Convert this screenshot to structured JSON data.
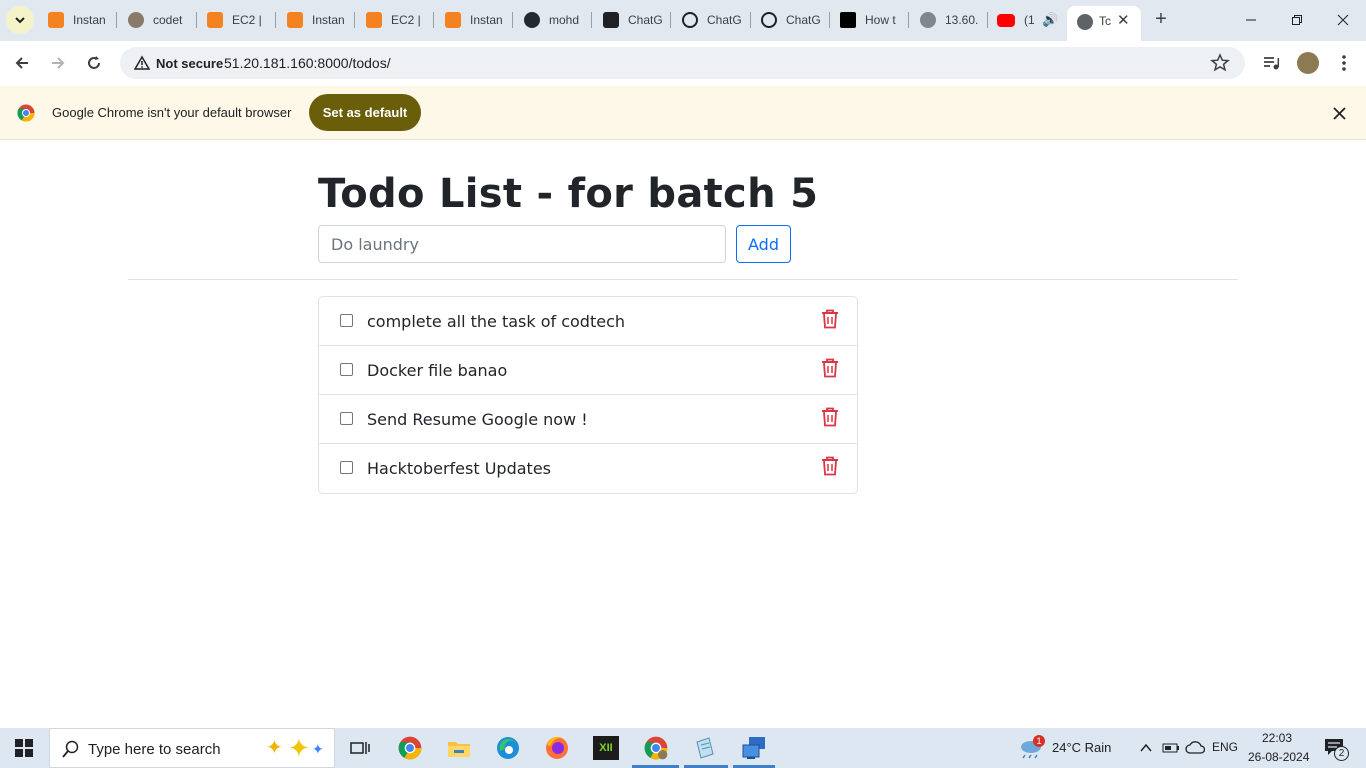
{
  "browser": {
    "tabs": [
      {
        "label": "Instan",
        "icon": "aws-icon"
      },
      {
        "label": "codet",
        "icon": "avatar-icon"
      },
      {
        "label": "EC2 | ",
        "icon": "aws-icon"
      },
      {
        "label": "Instan",
        "icon": "aws-icon"
      },
      {
        "label": "EC2 | ",
        "icon": "aws-icon"
      },
      {
        "label": "Instan",
        "icon": "aws-icon"
      },
      {
        "label": "mohd",
        "icon": "github-icon"
      },
      {
        "label": "ChatG",
        "icon": "chatgpt-icon"
      },
      {
        "label": "ChatG",
        "icon": "chatgpt-icon"
      },
      {
        "label": "ChatG",
        "icon": "chatgpt-icon"
      },
      {
        "label": "How t",
        "icon": "medium-icon"
      },
      {
        "label": "13.60.",
        "icon": "globe-icon"
      },
      {
        "label": "(1",
        "icon": "youtube-icon"
      },
      {
        "label": "Tc",
        "icon": "globe-icon",
        "active": true
      }
    ],
    "security_label": "Not secure",
    "url": "51.20.181.160:8000/todos/",
    "infobar": {
      "message": "Google Chrome isn't your default browser",
      "button": "Set as default"
    }
  },
  "page": {
    "title": "Todo List - for batch 5",
    "input_placeholder": "Do laundry",
    "add_label": "Add",
    "todos": [
      {
        "text": "complete all the task of codtech",
        "done": false
      },
      {
        "text": "Docker file banao",
        "done": false
      },
      {
        "text": "Send Resume Google now !",
        "done": false
      },
      {
        "text": "Hacktoberfest Updates",
        "done": false
      }
    ]
  },
  "taskbar": {
    "search_placeholder": "Type here to search",
    "weather": "24°C  Rain",
    "weather_badge": "1",
    "language": "ENG",
    "time": "22:03",
    "date": "26-08-2024",
    "notification_count": "2"
  },
  "colors": {
    "accent": "#0d6efd",
    "delete": "#dc3545",
    "infobar_button": "#6b5e0a"
  }
}
